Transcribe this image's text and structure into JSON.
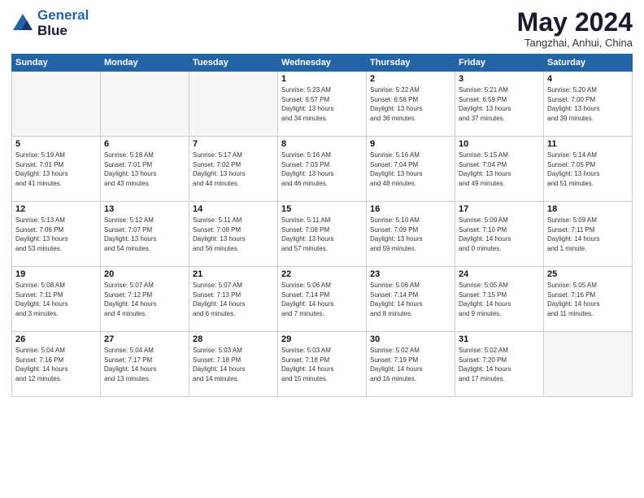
{
  "header": {
    "logo_line1": "General",
    "logo_line2": "Blue",
    "month_title": "May 2024",
    "subtitle": "Tangzhai, Anhui, China"
  },
  "weekdays": [
    "Sunday",
    "Monday",
    "Tuesday",
    "Wednesday",
    "Thursday",
    "Friday",
    "Saturday"
  ],
  "weeks": [
    [
      {
        "day": "",
        "detail": ""
      },
      {
        "day": "",
        "detail": ""
      },
      {
        "day": "",
        "detail": ""
      },
      {
        "day": "1",
        "detail": "Sunrise: 5:23 AM\nSunset: 6:57 PM\nDaylight: 13 hours\nand 34 minutes."
      },
      {
        "day": "2",
        "detail": "Sunrise: 5:22 AM\nSunset: 6:58 PM\nDaylight: 13 hours\nand 36 minutes."
      },
      {
        "day": "3",
        "detail": "Sunrise: 5:21 AM\nSunset: 6:59 PM\nDaylight: 13 hours\nand 37 minutes."
      },
      {
        "day": "4",
        "detail": "Sunrise: 5:20 AM\nSunset: 7:00 PM\nDaylight: 13 hours\nand 39 minutes."
      }
    ],
    [
      {
        "day": "5",
        "detail": "Sunrise: 5:19 AM\nSunset: 7:01 PM\nDaylight: 13 hours\nand 41 minutes."
      },
      {
        "day": "6",
        "detail": "Sunrise: 5:18 AM\nSunset: 7:01 PM\nDaylight: 13 hours\nand 43 minutes."
      },
      {
        "day": "7",
        "detail": "Sunrise: 5:17 AM\nSunset: 7:02 PM\nDaylight: 13 hours\nand 44 minutes."
      },
      {
        "day": "8",
        "detail": "Sunrise: 5:16 AM\nSunset: 7:03 PM\nDaylight: 13 hours\nand 46 minutes."
      },
      {
        "day": "9",
        "detail": "Sunrise: 5:16 AM\nSunset: 7:04 PM\nDaylight: 13 hours\nand 48 minutes."
      },
      {
        "day": "10",
        "detail": "Sunrise: 5:15 AM\nSunset: 7:04 PM\nDaylight: 13 hours\nand 49 minutes."
      },
      {
        "day": "11",
        "detail": "Sunrise: 5:14 AM\nSunset: 7:05 PM\nDaylight: 13 hours\nand 51 minutes."
      }
    ],
    [
      {
        "day": "12",
        "detail": "Sunrise: 5:13 AM\nSunset: 7:06 PM\nDaylight: 13 hours\nand 53 minutes."
      },
      {
        "day": "13",
        "detail": "Sunrise: 5:12 AM\nSunset: 7:07 PM\nDaylight: 13 hours\nand 54 minutes."
      },
      {
        "day": "14",
        "detail": "Sunrise: 5:11 AM\nSunset: 7:08 PM\nDaylight: 13 hours\nand 56 minutes."
      },
      {
        "day": "15",
        "detail": "Sunrise: 5:11 AM\nSunset: 7:08 PM\nDaylight: 13 hours\nand 57 minutes."
      },
      {
        "day": "16",
        "detail": "Sunrise: 5:10 AM\nSunset: 7:09 PM\nDaylight: 13 hours\nand 59 minutes."
      },
      {
        "day": "17",
        "detail": "Sunrise: 5:09 AM\nSunset: 7:10 PM\nDaylight: 14 hours\nand 0 minutes."
      },
      {
        "day": "18",
        "detail": "Sunrise: 5:09 AM\nSunset: 7:11 PM\nDaylight: 14 hours\nand 1 minute."
      }
    ],
    [
      {
        "day": "19",
        "detail": "Sunrise: 5:08 AM\nSunset: 7:11 PM\nDaylight: 14 hours\nand 3 minutes."
      },
      {
        "day": "20",
        "detail": "Sunrise: 5:07 AM\nSunset: 7:12 PM\nDaylight: 14 hours\nand 4 minutes."
      },
      {
        "day": "21",
        "detail": "Sunrise: 5:07 AM\nSunset: 7:13 PM\nDaylight: 14 hours\nand 6 minutes."
      },
      {
        "day": "22",
        "detail": "Sunrise: 5:06 AM\nSunset: 7:14 PM\nDaylight: 14 hours\nand 7 minutes."
      },
      {
        "day": "23",
        "detail": "Sunrise: 5:06 AM\nSunset: 7:14 PM\nDaylight: 14 hours\nand 8 minutes."
      },
      {
        "day": "24",
        "detail": "Sunrise: 5:05 AM\nSunset: 7:15 PM\nDaylight: 14 hours\nand 9 minutes."
      },
      {
        "day": "25",
        "detail": "Sunrise: 5:05 AM\nSunset: 7:16 PM\nDaylight: 14 hours\nand 11 minutes."
      }
    ],
    [
      {
        "day": "26",
        "detail": "Sunrise: 5:04 AM\nSunset: 7:16 PM\nDaylight: 14 hours\nand 12 minutes."
      },
      {
        "day": "27",
        "detail": "Sunrise: 5:04 AM\nSunset: 7:17 PM\nDaylight: 14 hours\nand 13 minutes."
      },
      {
        "day": "28",
        "detail": "Sunrise: 5:03 AM\nSunset: 7:18 PM\nDaylight: 14 hours\nand 14 minutes."
      },
      {
        "day": "29",
        "detail": "Sunrise: 5:03 AM\nSunset: 7:18 PM\nDaylight: 14 hours\nand 15 minutes."
      },
      {
        "day": "30",
        "detail": "Sunrise: 5:02 AM\nSunset: 7:19 PM\nDaylight: 14 hours\nand 16 minutes."
      },
      {
        "day": "31",
        "detail": "Sunrise: 5:02 AM\nSunset: 7:20 PM\nDaylight: 14 hours\nand 17 minutes."
      },
      {
        "day": "",
        "detail": ""
      }
    ]
  ]
}
